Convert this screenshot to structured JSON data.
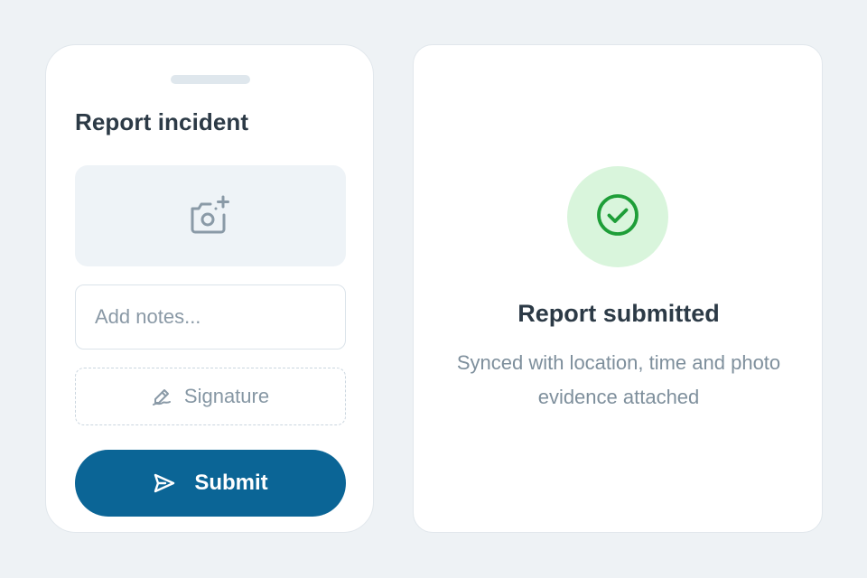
{
  "form": {
    "title": "Report incident",
    "photo_icon": "camera-add-icon",
    "notes_placeholder": "Add notes...",
    "notes_value": "",
    "signature_label": "Signature",
    "signature_icon": "pen-sign-icon",
    "submit_label": "Submit",
    "submit_icon": "send-icon"
  },
  "status": {
    "icon": "check-circle-icon",
    "title": "Report submitted",
    "description": "Synced with location, time and photo evidence attached"
  },
  "colors": {
    "background": "#eef2f5",
    "primary": "#0b6596",
    "success": "#1e9e38",
    "success_bg": "#d9f5dc",
    "text": "#2c3a46",
    "muted": "#7e8f9c"
  }
}
